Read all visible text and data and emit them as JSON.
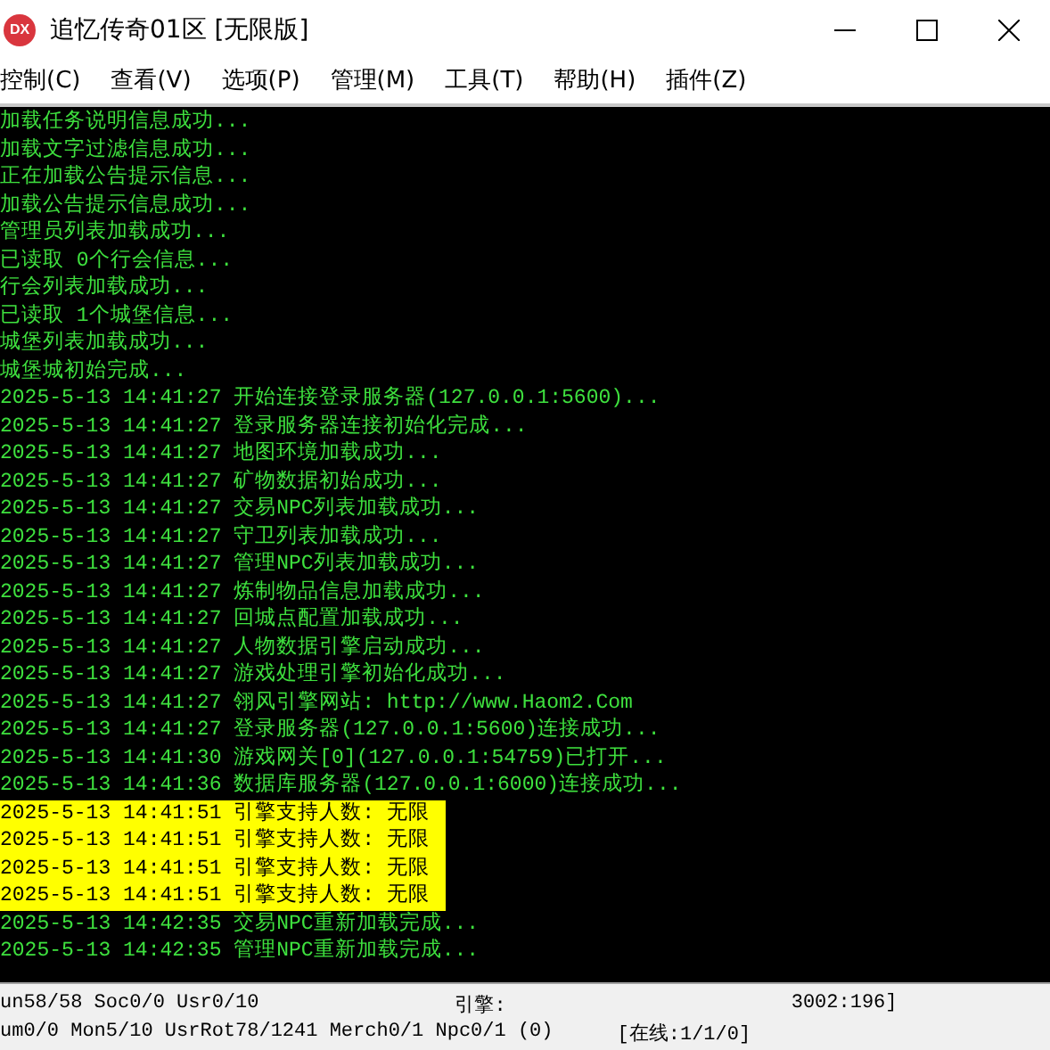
{
  "window": {
    "title": "追忆传奇01区 [无限版]",
    "icon": "DX"
  },
  "menu": [
    "控制(C)",
    "查看(V)",
    "选项(P)",
    "管理(M)",
    "工具(T)",
    "帮助(H)",
    "插件(Z)"
  ],
  "log": [
    {
      "text": "加载任务说明信息成功...",
      "highlighted": false
    },
    {
      "text": "加载文字过滤信息成功...",
      "highlighted": false
    },
    {
      "text": "正在加载公告提示信息...",
      "highlighted": false
    },
    {
      "text": "加载公告提示信息成功...",
      "highlighted": false
    },
    {
      "text": "管理员列表加载成功...",
      "highlighted": false
    },
    {
      "text": "已读取 0个行会信息...",
      "highlighted": false
    },
    {
      "text": "行会列表加载成功...",
      "highlighted": false
    },
    {
      "text": "已读取 1个城堡信息...",
      "highlighted": false
    },
    {
      "text": "城堡列表加载成功...",
      "highlighted": false
    },
    {
      "text": "城堡城初始完成...",
      "highlighted": false
    },
    {
      "text": "2025-5-13 14:41:27 开始连接登录服务器(127.0.0.1:5600)...",
      "highlighted": false
    },
    {
      "text": "2025-5-13 14:41:27 登录服务器连接初始化完成...",
      "highlighted": false
    },
    {
      "text": "2025-5-13 14:41:27 地图环境加载成功...",
      "highlighted": false
    },
    {
      "text": "2025-5-13 14:41:27 矿物数据初始成功...",
      "highlighted": false
    },
    {
      "text": "2025-5-13 14:41:27 交易NPC列表加载成功...",
      "highlighted": false
    },
    {
      "text": "2025-5-13 14:41:27 守卫列表加载成功...",
      "highlighted": false
    },
    {
      "text": "2025-5-13 14:41:27 管理NPC列表加载成功...",
      "highlighted": false
    },
    {
      "text": "2025-5-13 14:41:27 炼制物品信息加载成功...",
      "highlighted": false
    },
    {
      "text": "2025-5-13 14:41:27 回城点配置加载成功...",
      "highlighted": false
    },
    {
      "text": "2025-5-13 14:41:27 人物数据引擎启动成功...",
      "highlighted": false
    },
    {
      "text": "2025-5-13 14:41:27 游戏处理引擎初始化成功...",
      "highlighted": false
    },
    {
      "text": "2025-5-13 14:41:27 翎风引擎网站: http://www.Haom2.Com",
      "highlighted": false
    },
    {
      "text": "2025-5-13 14:41:27 登录服务器(127.0.0.1:5600)连接成功...",
      "highlighted": false
    },
    {
      "text": "2025-5-13 14:41:30 游戏网关[0](127.0.0.1:54759)已打开...",
      "highlighted": false
    },
    {
      "text": "2025-5-13 14:41:36 数据库服务器(127.0.0.1:6000)连接成功...",
      "highlighted": false
    },
    {
      "text": "2025-5-13 14:41:51 引擎支持人数: 无限",
      "highlighted": true
    },
    {
      "text": "2025-5-13 14:41:51 引擎支持人数: 无限",
      "highlighted": true
    },
    {
      "text": "2025-5-13 14:41:51 引擎支持人数: 无限",
      "highlighted": true
    },
    {
      "text": "2025-5-13 14:41:51 引擎支持人数: 无限",
      "highlighted": true
    },
    {
      "text": "2025-5-13 14:42:35 交易NPC重新加载完成...",
      "highlighted": false
    },
    {
      "text": "2025-5-13 14:42:35 管理NPC重新加载完成...",
      "highlighted": false
    }
  ],
  "status_bar": [
    [
      "un58/58 Soc0/0 Usr0/10",
      "引擎:",
      "3002:196]"
    ],
    [
      "um0/0 Mon5/10 UsrRot78/1241 Merch0/1 Npc0/1 (0)",
      "[在线:1/1/0]"
    ]
  ]
}
